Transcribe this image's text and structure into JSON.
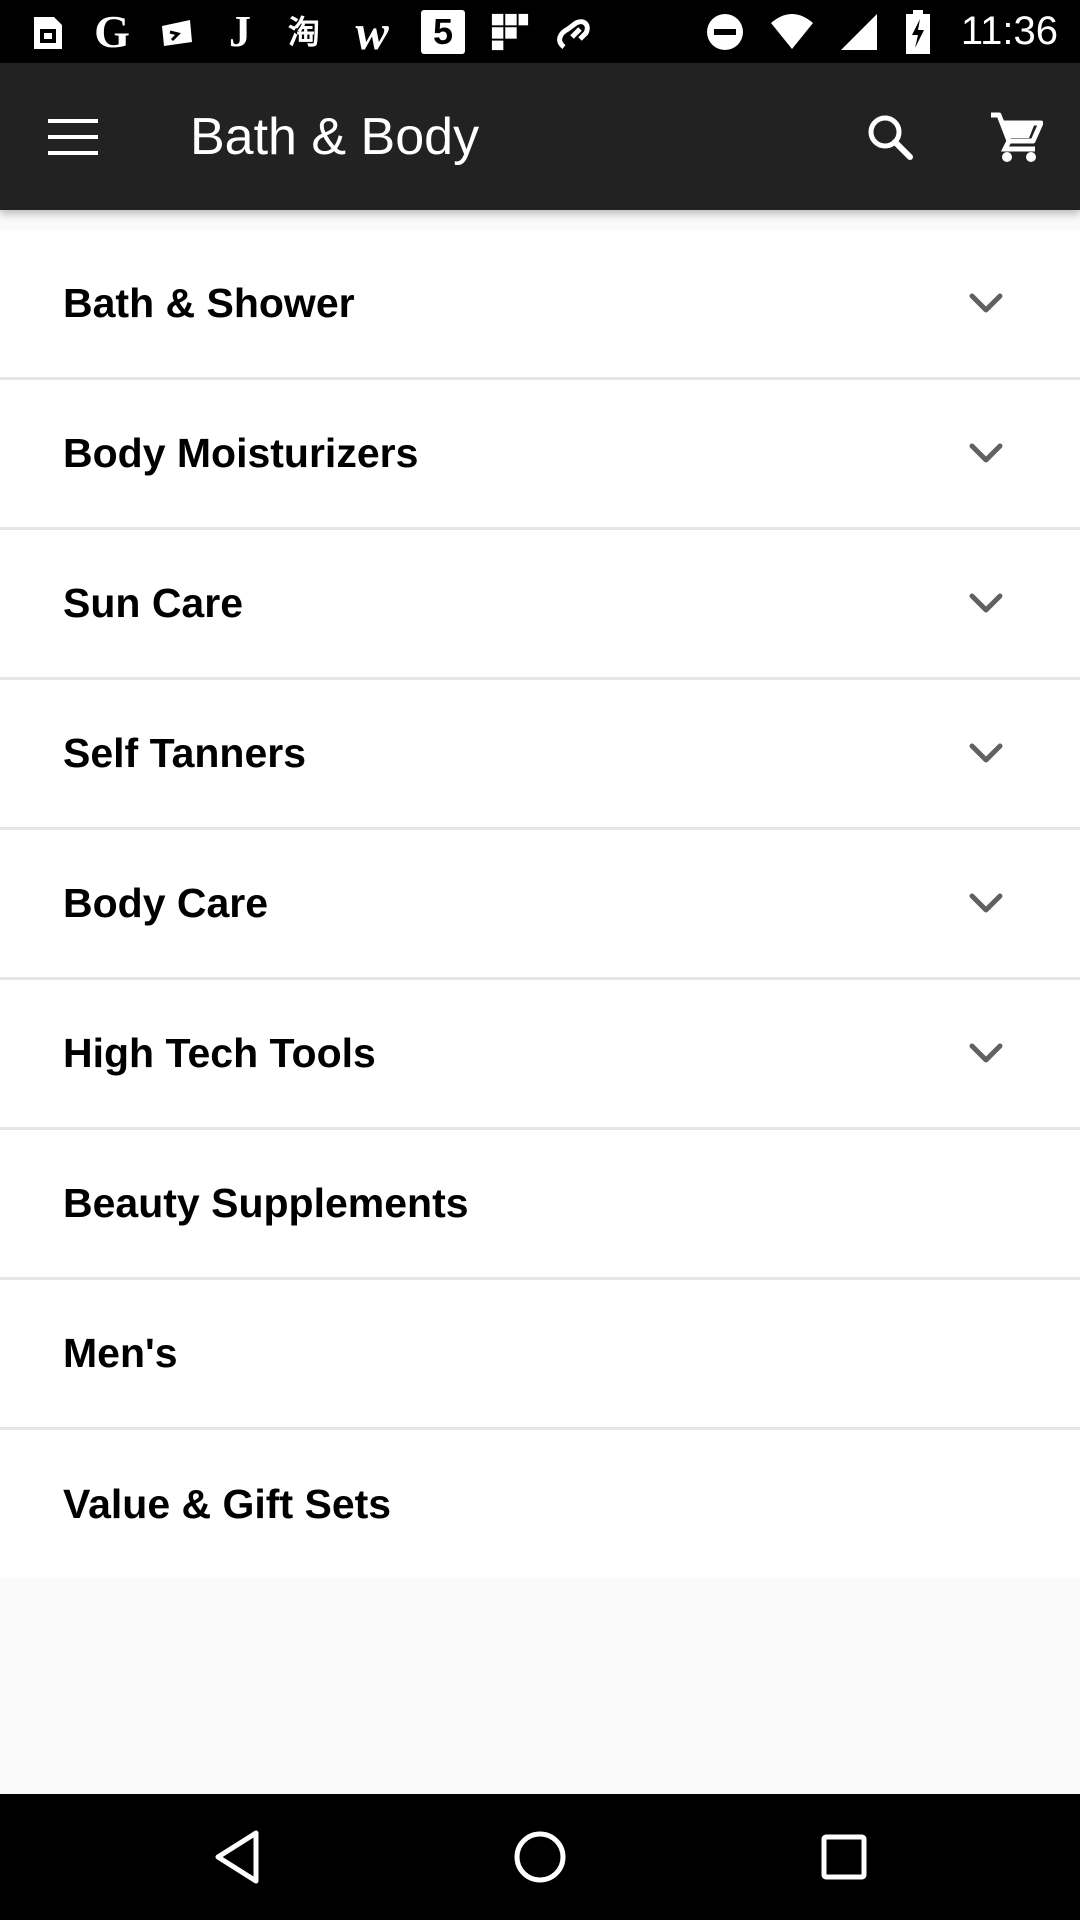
{
  "status_bar": {
    "time": "11:36",
    "left_icons": [
      "sim-card-icon",
      "google-icon",
      "bag-icon",
      "j-icon",
      "taobao-icon",
      "w-icon",
      "calendar-5-icon",
      "grid-icon",
      "link-icon"
    ],
    "right_icons": [
      "do-not-disturb-icon",
      "wifi-icon",
      "signal-icon",
      "battery-charging-icon"
    ],
    "google_glyph": "G",
    "j_glyph": "J",
    "taobao_glyph": "淘",
    "w_glyph": "w",
    "calendar_glyph": "5"
  },
  "app_bar": {
    "title": "Bath & Body",
    "background": "#222222",
    "icons": [
      "menu-icon",
      "search-icon",
      "cart-icon"
    ]
  },
  "categories": [
    {
      "label": "Bath & Shower",
      "expandable": true
    },
    {
      "label": "Body Moisturizers",
      "expandable": true
    },
    {
      "label": "Sun Care",
      "expandable": true
    },
    {
      "label": "Self Tanners",
      "expandable": true
    },
    {
      "label": "Body Care",
      "expandable": true
    },
    {
      "label": "High Tech Tools",
      "expandable": true
    },
    {
      "label": "Beauty Supplements",
      "expandable": false
    },
    {
      "label": "Men's",
      "expandable": false
    },
    {
      "label": "Value & Gift Sets",
      "expandable": false
    }
  ],
  "nav_bar": {
    "icons": [
      "back-icon",
      "home-icon",
      "recents-icon"
    ]
  }
}
